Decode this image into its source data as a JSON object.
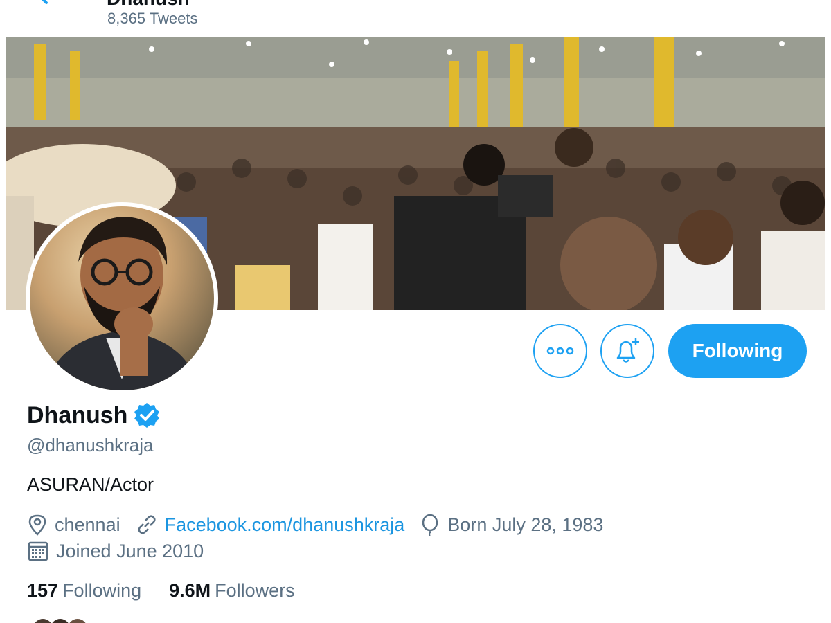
{
  "header": {
    "name": "Dhanush",
    "tweet_count": "8,365 Tweets"
  },
  "profile": {
    "display_name": "Dhanush",
    "handle": "@dhanushkraja",
    "bio": "ASURAN/Actor",
    "location": "chennai",
    "website": "Facebook.com/dhanushkraja",
    "birthday": "Born July 28, 1983",
    "joined": "Joined June 2010"
  },
  "stats": {
    "following_count": "157",
    "following_label": "Following",
    "followers_count": "9.6M",
    "followers_label": "Followers"
  },
  "actions": {
    "following_button": "Following"
  },
  "colors": {
    "accent": "#1da1f2",
    "link": "#1b95e0",
    "secondary_text": "#5b7083"
  },
  "icons": [
    "back-arrow-icon",
    "more-icon",
    "bell-plus-icon",
    "verified-icon",
    "location-icon",
    "link-icon",
    "balloon-icon",
    "calendar-icon"
  ]
}
